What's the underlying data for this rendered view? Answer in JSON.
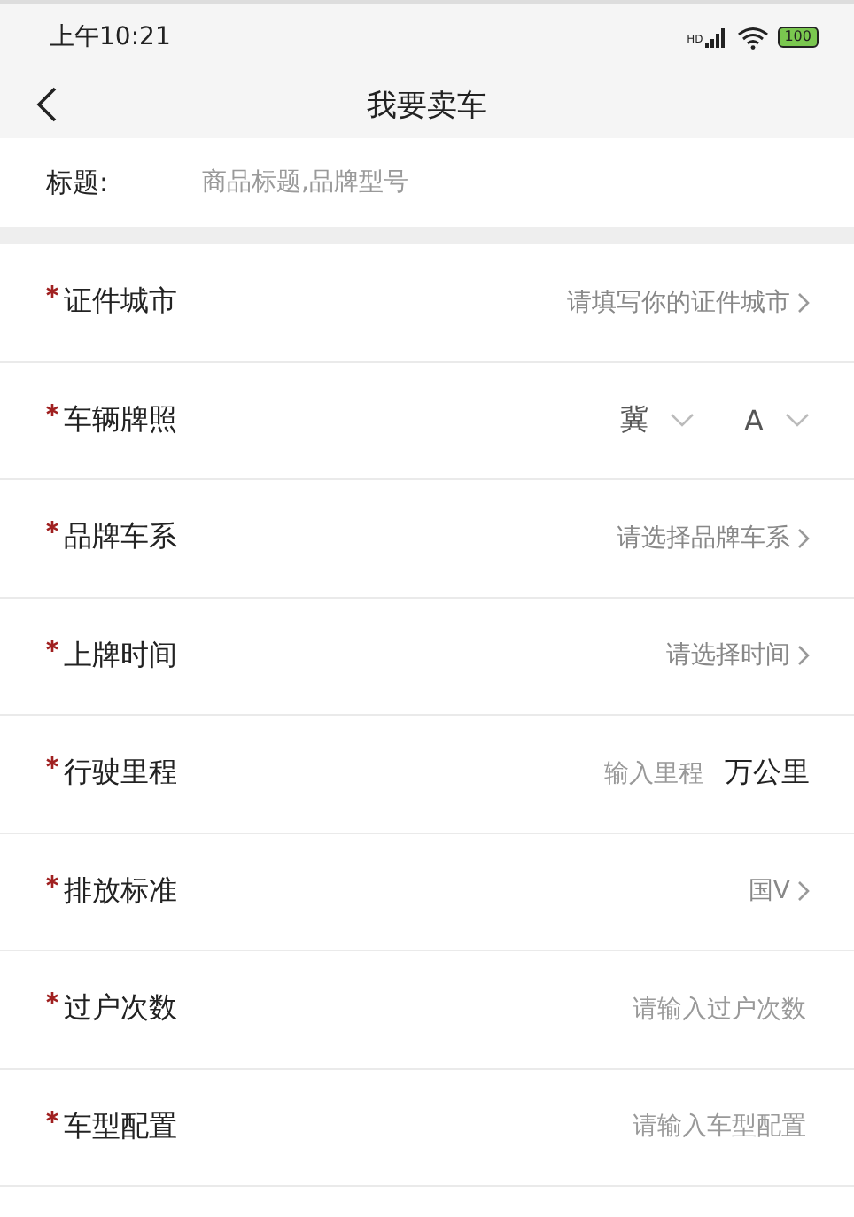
{
  "status_bar": {
    "time": "上午10:21",
    "signal_label": "HD",
    "battery": "100"
  },
  "nav": {
    "title": "我要卖车"
  },
  "title_field": {
    "label": "标题:",
    "placeholder": "商品标题,品牌型号"
  },
  "rows": [
    {
      "kind": "select",
      "label": "证件城市",
      "required": true,
      "value": "请填写你的证件城市"
    },
    {
      "kind": "plate",
      "label": "车辆牌照",
      "required": true,
      "province": "冀",
      "letter": "A"
    },
    {
      "kind": "select",
      "label": "品牌车系",
      "required": true,
      "value": "请选择品牌车系"
    },
    {
      "kind": "select",
      "label": "上牌时间",
      "required": true,
      "value": "请选择时间"
    },
    {
      "kind": "input",
      "label": "行驶里程",
      "required": true,
      "placeholder": "输入里程",
      "unit": "万公里"
    },
    {
      "kind": "select",
      "label": "排放标准",
      "required": true,
      "value": "国V"
    },
    {
      "kind": "input",
      "label": "过户次数",
      "required": true,
      "placeholder": "请输入过户次数"
    },
    {
      "kind": "input",
      "label": "车型配置",
      "required": true,
      "placeholder": "请输入车型配置"
    }
  ]
}
